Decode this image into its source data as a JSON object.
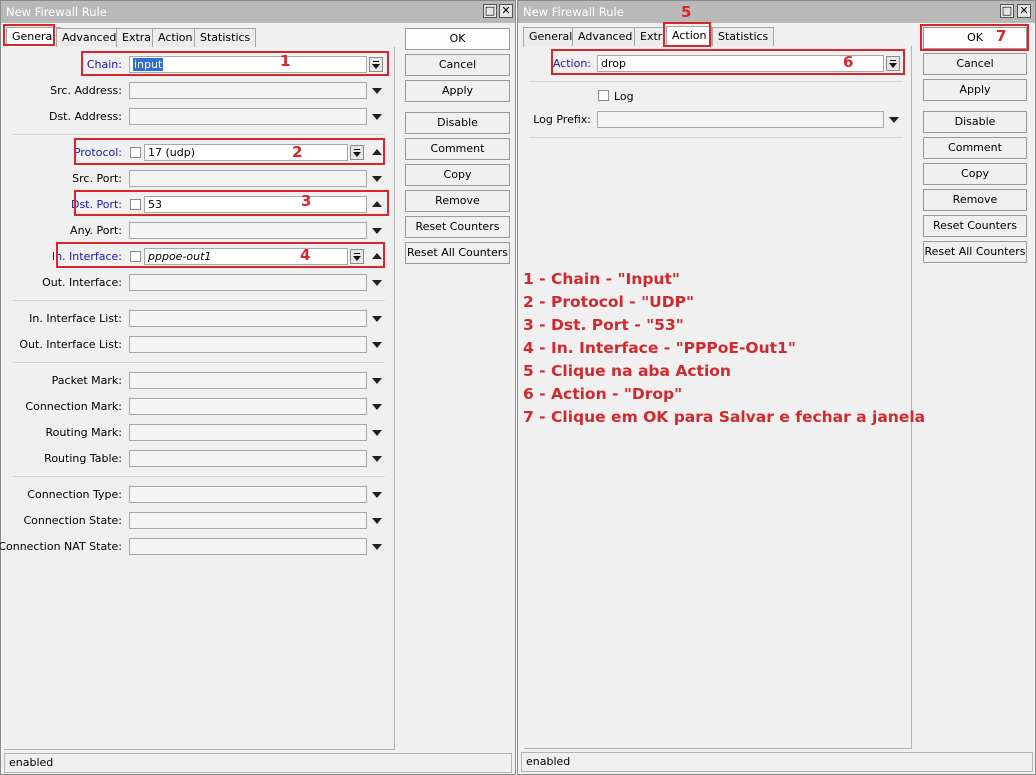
{
  "left_window": {
    "title": "New Firewall Rule",
    "tabs": [
      "General",
      "Advanced",
      "Extra",
      "Action",
      "Statistics"
    ],
    "active_tab": "General",
    "fields": {
      "chain": {
        "label": "Chain:",
        "value": "input"
      },
      "src_address": {
        "label": "Src. Address:",
        "value": ""
      },
      "dst_address": {
        "label": "Dst. Address:",
        "value": ""
      },
      "protocol": {
        "label": "Protocol:",
        "value": "17 (udp)"
      },
      "src_port": {
        "label": "Src. Port:",
        "value": ""
      },
      "dst_port": {
        "label": "Dst. Port:",
        "value": "53"
      },
      "any_port": {
        "label": "Any. Port:",
        "value": ""
      },
      "in_interface": {
        "label": "In. Interface:",
        "value": "pppoe-out1"
      },
      "out_interface": {
        "label": "Out. Interface:",
        "value": ""
      },
      "in_interface_list": {
        "label": "In. Interface List:",
        "value": ""
      },
      "out_interface_list": {
        "label": "Out. Interface List:",
        "value": ""
      },
      "packet_mark": {
        "label": "Packet Mark:",
        "value": ""
      },
      "connection_mark": {
        "label": "Connection Mark:",
        "value": ""
      },
      "routing_mark": {
        "label": "Routing Mark:",
        "value": ""
      },
      "routing_table": {
        "label": "Routing Table:",
        "value": ""
      },
      "connection_type": {
        "label": "Connection Type:",
        "value": ""
      },
      "connection_state": {
        "label": "Connection State:",
        "value": ""
      },
      "connection_nat_state": {
        "label": "Connection NAT State:",
        "value": ""
      }
    },
    "buttons": [
      "OK",
      "Cancel",
      "Apply",
      "Disable",
      "Comment",
      "Copy",
      "Remove",
      "Reset Counters",
      "Reset All Counters"
    ],
    "status": "enabled"
  },
  "right_window": {
    "title": "New Firewall Rule",
    "tabs": [
      "General",
      "Advanced",
      "Extra",
      "Action",
      "Statistics"
    ],
    "active_tab": "Action",
    "fields": {
      "action": {
        "label": "Action:",
        "value": "drop"
      },
      "log": {
        "label": "Log"
      },
      "log_prefix": {
        "label": "Log Prefix:",
        "value": ""
      }
    },
    "buttons": [
      "OK",
      "Cancel",
      "Apply",
      "Disable",
      "Comment",
      "Copy",
      "Remove",
      "Reset Counters",
      "Reset All Counters"
    ],
    "status": "enabled"
  },
  "annotations": {
    "markers": [
      "1",
      "2",
      "3",
      "4",
      "5",
      "6",
      "7"
    ],
    "instructions": [
      "1 - Chain - \"Input\"",
      "2 - Protocol - \"UDP\"",
      "3 - Dst. Port - \"53\"",
      "4 - In. Interface - \"PPPoE-Out1\"",
      "5 - Clique na aba Action",
      "6 - Action - \"Drop\"",
      "7 - Clique em OK para Salvar e fechar a janela"
    ],
    "color": "#d8262b"
  }
}
